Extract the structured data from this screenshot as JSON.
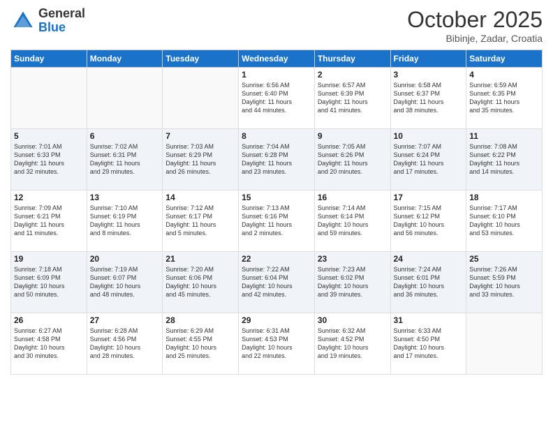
{
  "logo": {
    "general": "General",
    "blue": "Blue"
  },
  "title": "October 2025",
  "location": "Bibinje, Zadar, Croatia",
  "days_of_week": [
    "Sunday",
    "Monday",
    "Tuesday",
    "Wednesday",
    "Thursday",
    "Friday",
    "Saturday"
  ],
  "weeks": [
    [
      {
        "day": "",
        "info": ""
      },
      {
        "day": "",
        "info": ""
      },
      {
        "day": "",
        "info": ""
      },
      {
        "day": "1",
        "info": "Sunrise: 6:56 AM\nSunset: 6:40 PM\nDaylight: 11 hours\nand 44 minutes."
      },
      {
        "day": "2",
        "info": "Sunrise: 6:57 AM\nSunset: 6:39 PM\nDaylight: 11 hours\nand 41 minutes."
      },
      {
        "day": "3",
        "info": "Sunrise: 6:58 AM\nSunset: 6:37 PM\nDaylight: 11 hours\nand 38 minutes."
      },
      {
        "day": "4",
        "info": "Sunrise: 6:59 AM\nSunset: 6:35 PM\nDaylight: 11 hours\nand 35 minutes."
      }
    ],
    [
      {
        "day": "5",
        "info": "Sunrise: 7:01 AM\nSunset: 6:33 PM\nDaylight: 11 hours\nand 32 minutes."
      },
      {
        "day": "6",
        "info": "Sunrise: 7:02 AM\nSunset: 6:31 PM\nDaylight: 11 hours\nand 29 minutes."
      },
      {
        "day": "7",
        "info": "Sunrise: 7:03 AM\nSunset: 6:29 PM\nDaylight: 11 hours\nand 26 minutes."
      },
      {
        "day": "8",
        "info": "Sunrise: 7:04 AM\nSunset: 6:28 PM\nDaylight: 11 hours\nand 23 minutes."
      },
      {
        "day": "9",
        "info": "Sunrise: 7:05 AM\nSunset: 6:26 PM\nDaylight: 11 hours\nand 20 minutes."
      },
      {
        "day": "10",
        "info": "Sunrise: 7:07 AM\nSunset: 6:24 PM\nDaylight: 11 hours\nand 17 minutes."
      },
      {
        "day": "11",
        "info": "Sunrise: 7:08 AM\nSunset: 6:22 PM\nDaylight: 11 hours\nand 14 minutes."
      }
    ],
    [
      {
        "day": "12",
        "info": "Sunrise: 7:09 AM\nSunset: 6:21 PM\nDaylight: 11 hours\nand 11 minutes."
      },
      {
        "day": "13",
        "info": "Sunrise: 7:10 AM\nSunset: 6:19 PM\nDaylight: 11 hours\nand 8 minutes."
      },
      {
        "day": "14",
        "info": "Sunrise: 7:12 AM\nSunset: 6:17 PM\nDaylight: 11 hours\nand 5 minutes."
      },
      {
        "day": "15",
        "info": "Sunrise: 7:13 AM\nSunset: 6:16 PM\nDaylight: 11 hours\nand 2 minutes."
      },
      {
        "day": "16",
        "info": "Sunrise: 7:14 AM\nSunset: 6:14 PM\nDaylight: 10 hours\nand 59 minutes."
      },
      {
        "day": "17",
        "info": "Sunrise: 7:15 AM\nSunset: 6:12 PM\nDaylight: 10 hours\nand 56 minutes."
      },
      {
        "day": "18",
        "info": "Sunrise: 7:17 AM\nSunset: 6:10 PM\nDaylight: 10 hours\nand 53 minutes."
      }
    ],
    [
      {
        "day": "19",
        "info": "Sunrise: 7:18 AM\nSunset: 6:09 PM\nDaylight: 10 hours\nand 50 minutes."
      },
      {
        "day": "20",
        "info": "Sunrise: 7:19 AM\nSunset: 6:07 PM\nDaylight: 10 hours\nand 48 minutes."
      },
      {
        "day": "21",
        "info": "Sunrise: 7:20 AM\nSunset: 6:06 PM\nDaylight: 10 hours\nand 45 minutes."
      },
      {
        "day": "22",
        "info": "Sunrise: 7:22 AM\nSunset: 6:04 PM\nDaylight: 10 hours\nand 42 minutes."
      },
      {
        "day": "23",
        "info": "Sunrise: 7:23 AM\nSunset: 6:02 PM\nDaylight: 10 hours\nand 39 minutes."
      },
      {
        "day": "24",
        "info": "Sunrise: 7:24 AM\nSunset: 6:01 PM\nDaylight: 10 hours\nand 36 minutes."
      },
      {
        "day": "25",
        "info": "Sunrise: 7:26 AM\nSunset: 5:59 PM\nDaylight: 10 hours\nand 33 minutes."
      }
    ],
    [
      {
        "day": "26",
        "info": "Sunrise: 6:27 AM\nSunset: 4:58 PM\nDaylight: 10 hours\nand 30 minutes."
      },
      {
        "day": "27",
        "info": "Sunrise: 6:28 AM\nSunset: 4:56 PM\nDaylight: 10 hours\nand 28 minutes."
      },
      {
        "day": "28",
        "info": "Sunrise: 6:29 AM\nSunset: 4:55 PM\nDaylight: 10 hours\nand 25 minutes."
      },
      {
        "day": "29",
        "info": "Sunrise: 6:31 AM\nSunset: 4:53 PM\nDaylight: 10 hours\nand 22 minutes."
      },
      {
        "day": "30",
        "info": "Sunrise: 6:32 AM\nSunset: 4:52 PM\nDaylight: 10 hours\nand 19 minutes."
      },
      {
        "day": "31",
        "info": "Sunrise: 6:33 AM\nSunset: 4:50 PM\nDaylight: 10 hours\nand 17 minutes."
      },
      {
        "day": "",
        "info": ""
      }
    ]
  ]
}
